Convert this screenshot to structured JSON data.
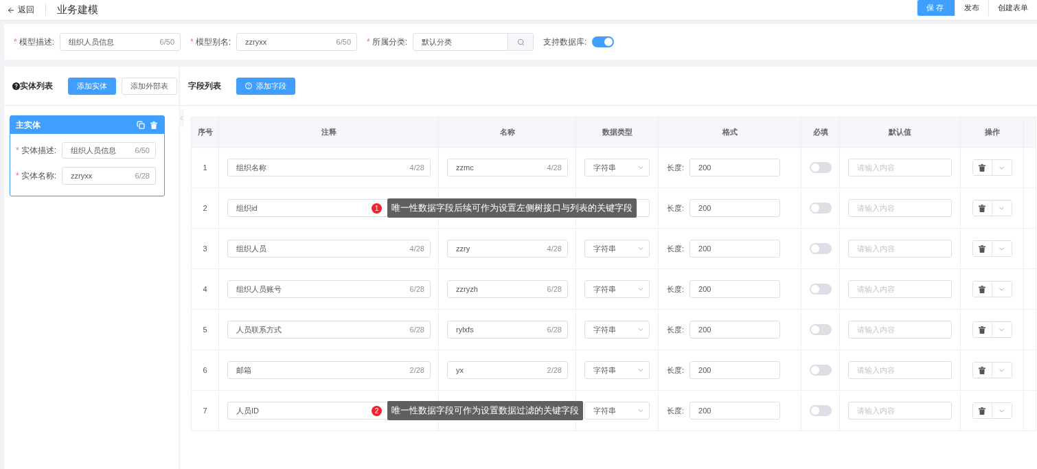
{
  "header": {
    "back": "返回",
    "title": "业务建模",
    "actions": [
      {
        "label": "保存",
        "primary": true
      },
      {
        "label": "发布",
        "primary": false
      },
      {
        "label": "创建表单",
        "primary": false
      }
    ]
  },
  "model_form": {
    "fields": [
      {
        "kind": "input",
        "required_mark": "*",
        "label": "模型描述:",
        "value": "组织人员信息",
        "counter": "6/50"
      },
      {
        "kind": "input",
        "required_mark": "*",
        "label": "模型别名:",
        "value": "zzryxx",
        "counter": "6/50"
      },
      {
        "kind": "search",
        "required_mark": "*",
        "label": "所属分类:",
        "value": "默认分类"
      },
      {
        "kind": "switch",
        "label": "支持数据库:",
        "on": true
      }
    ]
  },
  "entity_panel": {
    "title": "实体列表",
    "buttons": [
      {
        "label": "添加实体",
        "primary": true
      },
      {
        "label": "添加外部表",
        "primary": false
      }
    ],
    "entities": [
      {
        "name": "主实体",
        "selected": true,
        "fields": [
          {
            "kind": "textarea",
            "required_mark": "*",
            "label": "实体描述:",
            "value": "组织人员信息",
            "counter": "6/50"
          },
          {
            "kind": "input",
            "required_mark": "*",
            "label": "实体名称:",
            "value": "zzryxx",
            "counter": "6/28"
          }
        ]
      }
    ]
  },
  "field_panel": {
    "title": "字段列表",
    "add_button": "添加字段",
    "table": {
      "columns": [
        "序号",
        "注释",
        "名称",
        "数据类型",
        "格式",
        "必填",
        "默认值",
        "操作"
      ],
      "rows": [
        {
          "index": "1",
          "comment": {
            "value": "组织名称",
            "counter": "4/28"
          },
          "name": {
            "value": "zzmc",
            "counter": "4/28"
          },
          "data_type": "字符串",
          "length_label": "长度:",
          "length": "200",
          "required": false,
          "default_placeholder": "请输入内容"
        },
        {
          "index": "2",
          "comment": {
            "value": "组织id"
          },
          "length_label": "长度:",
          "length": "200",
          "required": false,
          "default_placeholder": "请输入内容",
          "annotation": {
            "number": "1",
            "text": "唯一性数据字段后续可作为设置左侧树接口与列表的关键字段"
          }
        },
        {
          "index": "3",
          "comment": {
            "value": "组织人员",
            "counter": "4/28"
          },
          "name": {
            "value": "zzry",
            "counter": "4/28"
          },
          "data_type": "字符串",
          "length_label": "长度:",
          "length": "200",
          "required": false,
          "default_placeholder": "请输入内容"
        },
        {
          "index": "4",
          "comment": {
            "value": "组织人员账号",
            "counter": "6/28"
          },
          "name": {
            "value": "zzryzh",
            "counter": "6/28"
          },
          "data_type": "字符串",
          "length_label": "长度:",
          "length": "200",
          "required": false,
          "default_placeholder": "请输入内容"
        },
        {
          "index": "5",
          "comment": {
            "value": "人员联系方式",
            "counter": "6/28"
          },
          "name": {
            "value": "rylxfs",
            "counter": "6/28"
          },
          "data_type": "字符串",
          "length_label": "长度:",
          "length": "200",
          "required": false,
          "default_placeholder": "请输入内容"
        },
        {
          "index": "6",
          "comment": {
            "value": "邮箱",
            "counter": "2/28"
          },
          "name": {
            "value": "yx",
            "counter": "2/28"
          },
          "data_type": "字符串",
          "length_label": "长度:",
          "length": "200",
          "required": false,
          "default_placeholder": "请输入内容"
        },
        {
          "index": "7",
          "comment": {
            "value": "人员ID"
          },
          "data_type": "字符串",
          "length_label": "长度:",
          "length": "200",
          "required": false,
          "default_placeholder": "请输入内容",
          "annotation": {
            "number": "2",
            "text": "唯一性数据字段可作为设置数据过滤的关键字段"
          }
        }
      ]
    }
  }
}
